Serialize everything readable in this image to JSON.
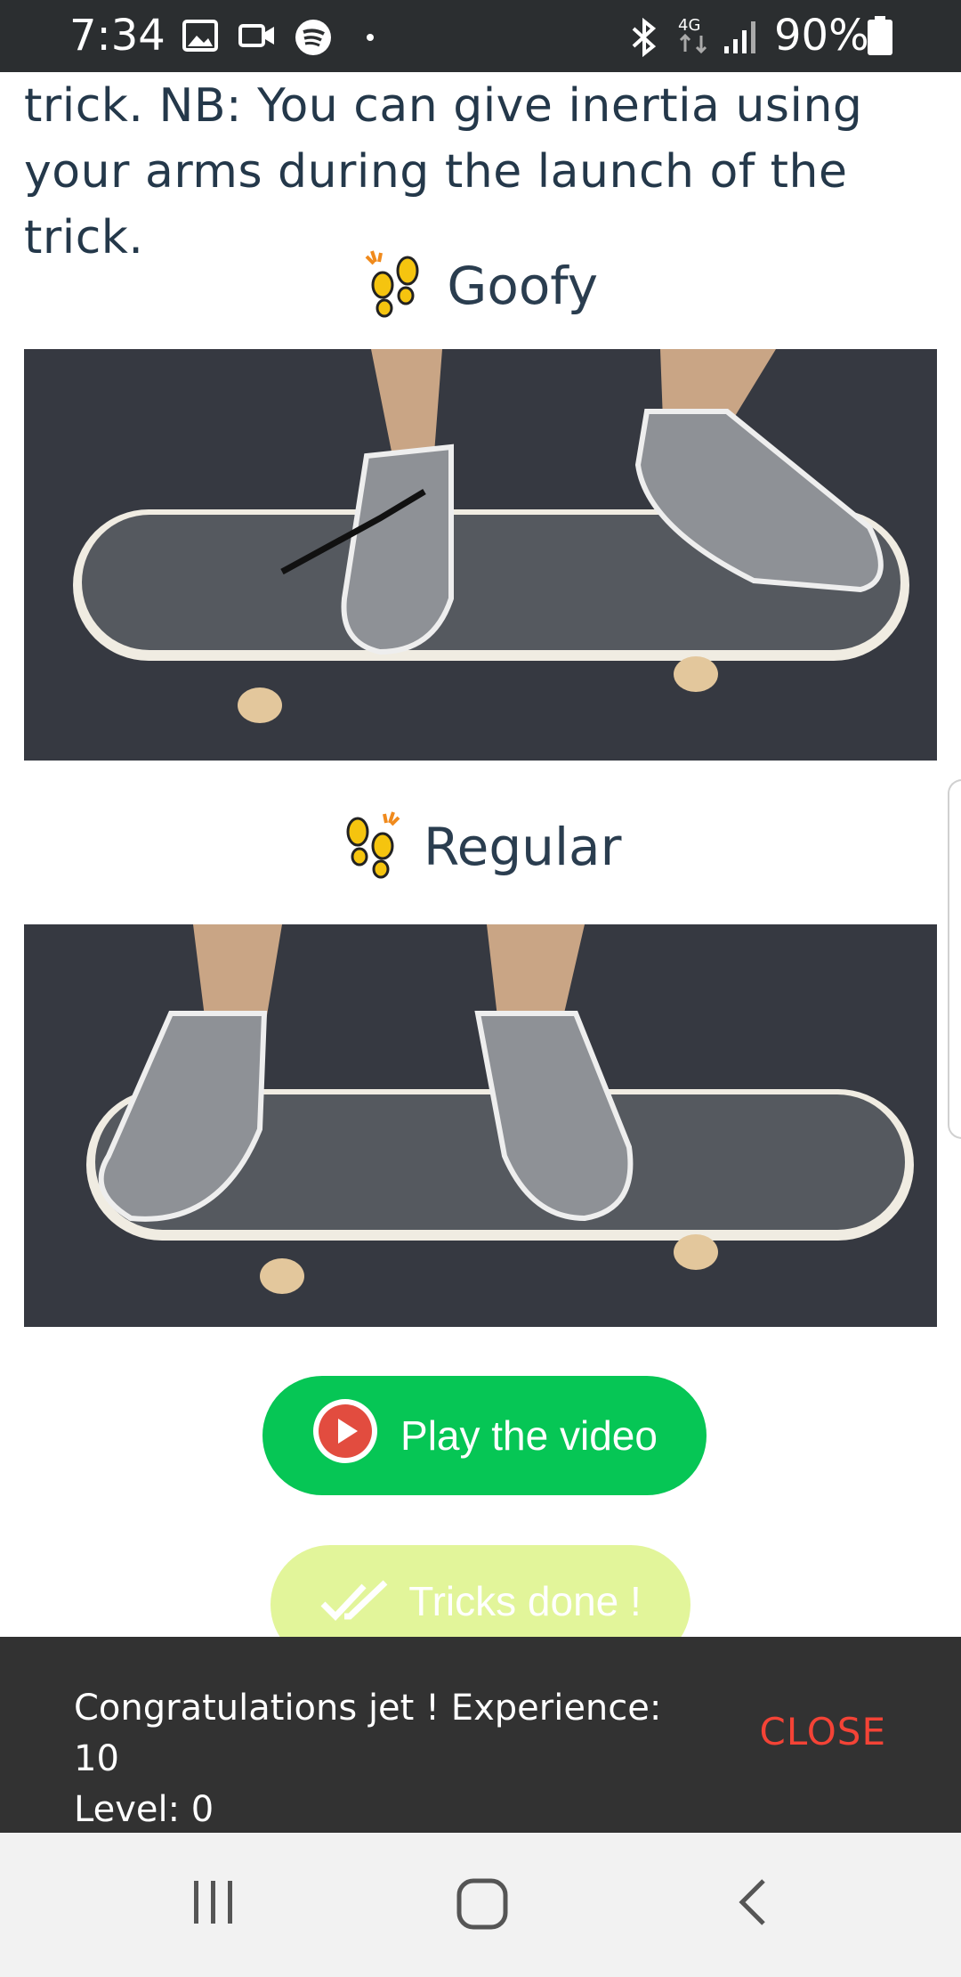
{
  "status_bar": {
    "time": "7:34",
    "battery": "90%",
    "icons": [
      "gallery-icon",
      "video-icon",
      "spotify-icon",
      "dot-icon",
      "bluetooth-icon",
      "4g-icon",
      "signal-icon",
      "battery-icon"
    ]
  },
  "content": {
    "intro_text": "trick. NB: You can give inertia using your arms during the launch of the trick.",
    "goofy_label": "Goofy",
    "regular_label": "Regular",
    "play_button": "Play the video",
    "done_button": "Tricks done !"
  },
  "snackbar": {
    "line1": "Congratulations jet ! Experience: 10",
    "line2": "Level: 0",
    "close": "CLOSE"
  },
  "colors": {
    "status_bar": "#2b2e30",
    "text_dark": "#24384a",
    "play_green": "#06c655",
    "done_lime": "#e2f59a",
    "snackbar_bg": "#323232",
    "close_red": "#f44336",
    "foot_yellow": "#f5c40f"
  },
  "nav": {
    "icons": [
      "recent-apps-icon",
      "home-icon",
      "back-icon"
    ]
  }
}
